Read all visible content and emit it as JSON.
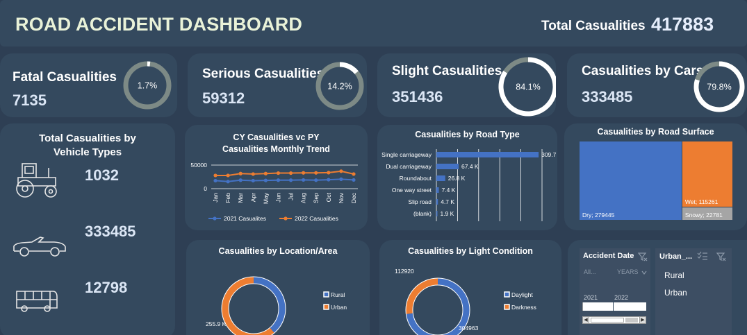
{
  "header": {
    "title": "ROAD ACCIDENT DASHBOARD",
    "total_label": "Total Casualities",
    "total_value": "417883"
  },
  "kpis": [
    {
      "label": "Fatal Casualities",
      "value": "7135",
      "pct_label": "1.7%",
      "pct": 0.017
    },
    {
      "label": "Serious Casualities",
      "value": "59312",
      "pct_label": "14.2%",
      "pct": 0.142
    },
    {
      "label": "Slight Casualities",
      "value": "351436",
      "pct_label": "84.1%",
      "pct": 0.841
    },
    {
      "label": "Casualities by Cars",
      "value": "333485",
      "pct_label": "79.8%",
      "pct": 0.798
    }
  ],
  "vehicle": {
    "title_line1": "Total Casualities by",
    "title_line2": "Vehicle Types",
    "items": [
      {
        "icon": "tractor-icon",
        "value": "1032"
      },
      {
        "icon": "car-icon",
        "value": "333485"
      },
      {
        "icon": "bus-icon",
        "value": "12798"
      }
    ]
  },
  "chart_data": [
    {
      "type": "line",
      "title": "CY Casualities vc PY Casualities Monthly Trend",
      "title_line1": "CY Casualities vc PY",
      "title_line2": "Casualities Monthly Trend",
      "categories": [
        "Jan",
        "Feb",
        "Mar",
        "Apr",
        "May",
        "Jun",
        "Jul",
        "Aug",
        "Sep",
        "Oct",
        "Nov",
        "Dec"
      ],
      "y_ticks": [
        "50000",
        "0"
      ],
      "ylim": [
        0,
        50000
      ],
      "series": [
        {
          "name": "2021 Casualites",
          "color": "#4472c4",
          "values": [
            17000,
            15000,
            18000,
            17000,
            17500,
            18000,
            18000,
            18500,
            18000,
            19000,
            20000,
            18500
          ]
        },
        {
          "name": "2022 Casualities",
          "color": "#ed7d31",
          "values": [
            28000,
            28000,
            32000,
            31000,
            32000,
            33000,
            33000,
            33500,
            33500,
            34000,
            37000,
            31000
          ]
        }
      ],
      "legend_position": "bottom"
    },
    {
      "type": "bar",
      "orientation": "horizontal",
      "title": "Casualities by Road Type",
      "categories": [
        "Single carriageway",
        "Dual carriageway",
        "Roundabout",
        "One way street",
        "Slip road",
        "(blank)"
      ],
      "values": [
        309.7,
        67.4,
        26.8,
        7.4,
        4.7,
        1.9
      ],
      "data_labels": [
        "309.7 K",
        "67.4 K",
        "26.8 K",
        "7.4 K",
        "4.7 K",
        "1.9 K"
      ],
      "color": "#4472c4"
    },
    {
      "type": "heatmap",
      "subtype": "treemap",
      "title": "Casualities by Road Surface",
      "categories": [
        "Dry",
        "Wet",
        "Snowy"
      ],
      "values": [
        279445,
        115261,
        22781
      ],
      "data_labels": [
        "Dry; 279445",
        "Wet; 115261",
        "Snowy; 22781"
      ],
      "colors": [
        "#4472c4",
        "#ed7d31",
        "#a5a5a5"
      ]
    },
    {
      "type": "pie",
      "subtype": "doughnut",
      "title": "Casualities by Location/Area",
      "categories": [
        "Rural",
        "Urban"
      ],
      "values": [
        162.0,
        255.9
      ],
      "data_labels": [
        "",
        "255.9 K"
      ],
      "colors": [
        "#4472c4",
        "#ed7d31"
      ],
      "legend_position": "right"
    },
    {
      "type": "pie",
      "subtype": "doughnut",
      "title": "Casualities by Light Condition",
      "categories": [
        "Daylight",
        "Darkness"
      ],
      "values": [
        304963,
        112920
      ],
      "data_labels": [
        "304963",
        "112920"
      ],
      "colors": [
        "#4472c4",
        "#ed7d31"
      ],
      "legend_position": "right"
    }
  ],
  "slicers": {
    "date": {
      "title": "Accident Date",
      "all_label": "All...",
      "years_label": "YEARS",
      "years": [
        "2021",
        "2022"
      ]
    },
    "urban": {
      "title": "Urban_...",
      "items": [
        "Rural",
        "Urban"
      ]
    }
  }
}
